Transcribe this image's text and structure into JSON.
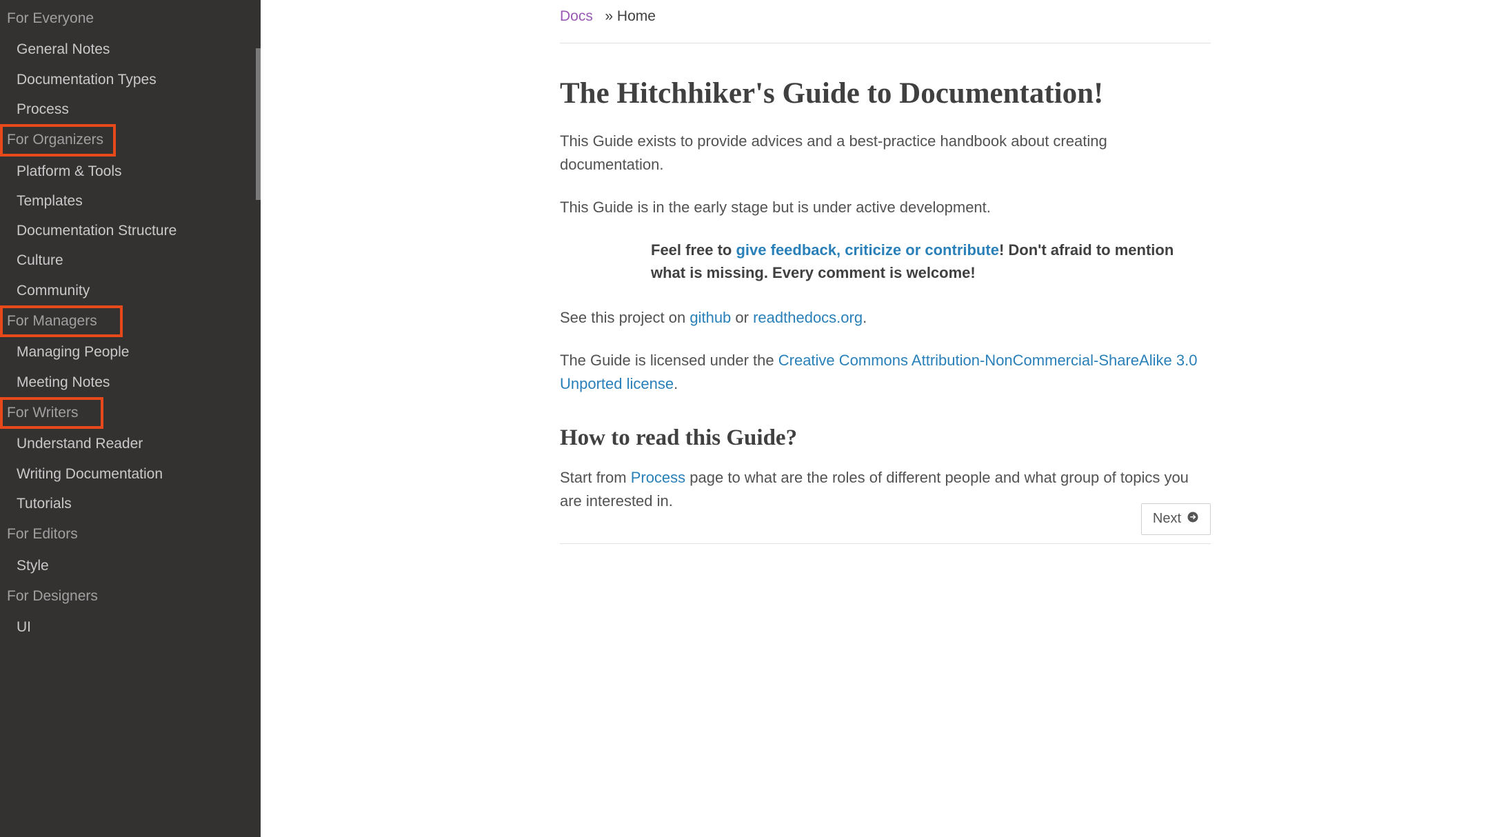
{
  "sidebar": {
    "sections": [
      {
        "caption": "For Everyone",
        "highlight": "",
        "items": [
          "General Notes",
          "Documentation Types",
          "Process"
        ]
      },
      {
        "caption": "For Organizers",
        "highlight": "hl-organizers",
        "items": [
          "Platform & Tools",
          "Templates",
          "Documentation Structure",
          "Culture",
          "Community"
        ]
      },
      {
        "caption": "For Managers",
        "highlight": "hl-managers",
        "items": [
          "Managing People",
          "Meeting Notes"
        ]
      },
      {
        "caption": "For Writers",
        "highlight": "hl-writers",
        "items": [
          "Understand Reader",
          "Writing Documentation",
          "Tutorials"
        ]
      },
      {
        "caption": "For Editors",
        "highlight": "",
        "items": [
          "Style"
        ]
      },
      {
        "caption": "For Designers",
        "highlight": "",
        "items": [
          "UI"
        ]
      }
    ]
  },
  "breadcrumb": {
    "docs_label": "Docs",
    "separator": "»",
    "current": "Home"
  },
  "content": {
    "title": "The Hitchhiker's Guide to Documentation!",
    "intro1": "This Guide exists to provide advices and a best-practice handbook about creating documentation.",
    "intro2": "This Guide is in the early stage but is under active development.",
    "callout_pre": "Feel free to ",
    "callout_link": "give feedback, criticize or contribute",
    "callout_post": "! Don't afraid to mention what is missing. Every comment is welcome!",
    "seeproj_pre": "See this project on ",
    "seeproj_github": "github",
    "seeproj_or": " or ",
    "seeproj_rtd": "readthedocs.org",
    "seeproj_post": ".",
    "license_pre": "The Guide is licensed under the ",
    "license_link": "Creative Commons Attribution-NonCommercial-ShareAlike 3.0 Unported license",
    "license_post": ".",
    "howto_heading": "How to read this Guide?",
    "howto_pre": "Start from ",
    "howto_link": "Process",
    "howto_post": " page to what are the roles of different people and what group of topics you are interested in."
  },
  "footer": {
    "next_label": "Next"
  }
}
